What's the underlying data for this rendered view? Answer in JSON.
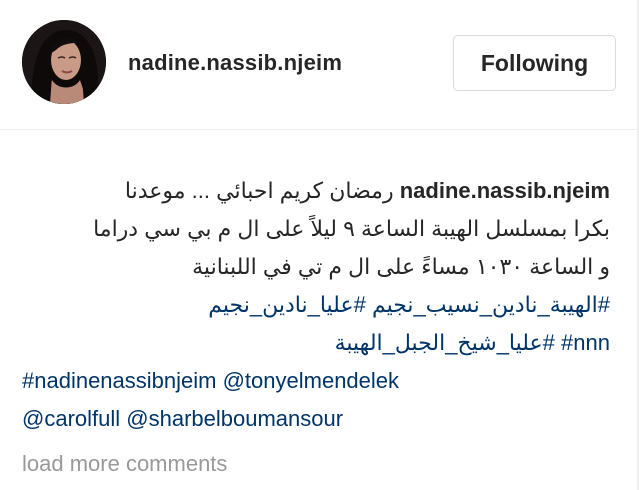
{
  "post": {
    "username": "nadine.nassib.njeim",
    "follow_button_label": "Following"
  },
  "caption": {
    "username": "nadine.nassib.njeim",
    "line1_text": "رمضان كريم احبائي ... موعدنا",
    "line2": "بكرا بمسلسل الهيبة الساعة ٩ ليلاً على ال م بي سي دراما",
    "line3": "و الساعة ١٠٣٠ مساءً على ال م تي في اللبنانية",
    "line4_tags": [
      "#الهيبة_نادين_نسيب_نجيم",
      "#عليا_نادين_نجيم"
    ],
    "line5_tags": [
      "#nnn",
      "#عليا_شيخ_الجبل_الهيبة"
    ],
    "line6_tags": [
      "#nadinenassibnjeim",
      "@tonyelmendelek"
    ],
    "line7_tags": [
      "@carolfull",
      "@sharbelboumansour"
    ]
  },
  "comments": {
    "load_more_label": "load more comments"
  },
  "colors": {
    "text": "#262626",
    "link": "#003569",
    "muted": "#999999",
    "border": "#dbdbdb"
  },
  "icons": {
    "avatar": "profile-photo"
  }
}
